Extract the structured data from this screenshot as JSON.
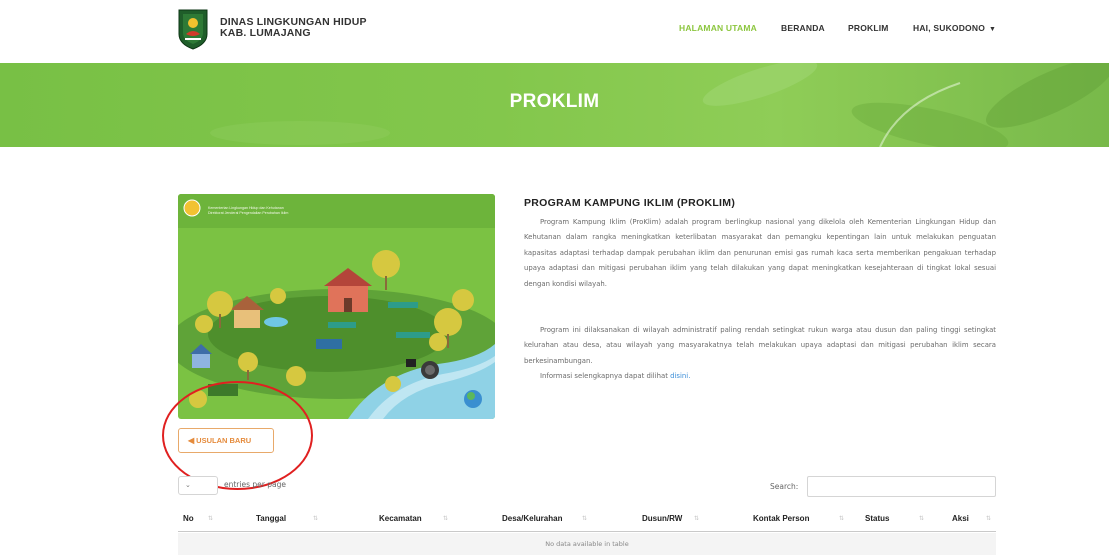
{
  "header": {
    "brand_line1": "DINAS LINGKUNGAN HIDUP",
    "brand_line2": "KAB. LUMAJANG",
    "nav": [
      {
        "label": "HALAMAN UTAMA"
      },
      {
        "label": "BERANDA"
      },
      {
        "label": "PROKLIM"
      },
      {
        "label": "HAI, SUKODONO"
      }
    ]
  },
  "banner": {
    "title": "PROKLIM"
  },
  "illustration": {
    "header_line1": "Kementerian Lingkungan Hidup dan Kehutanan",
    "header_line2": "Direktorat Jenderal Pengendalian Perubahan Iklim"
  },
  "article": {
    "title": "PROGRAM KAMPUNG IKLIM (PROKLIM)",
    "paragraph1": "Program Kampung Iklim (ProKlim) adalah program berlingkup nasional yang dikelola oleh Kementerian Lingkungan Hidup dan Kehutanan dalam rangka meningkatkan keterlibatan masyarakat dan pemangku kepentingan lain untuk melakukan penguatan kapasitas adaptasi terhadap dampak perubahan iklim dan penurunan emisi gas rumah kaca serta memberikan pengakuan terhadap upaya adaptasi dan mitigasi perubahan iklim yang telah dilakukan yang dapat meningkatkan kesejahteraan di tingkat lokal sesuai dengan kondisi wilayah.",
    "paragraph2": "Program ini dilaksanakan di wilayah administratif paling rendah setingkat rukun warga atau dusun dan paling tinggi setingkat kelurahan atau desa, atau wilayah yang masyarakatnya telah melakukan upaya adaptasi dan mitigasi perubahan iklim secara berkesinambungan.",
    "paragraph3_text": "Informasi selengkapnya dapat dilihat",
    "paragraph3_link": "disini."
  },
  "actions": {
    "new_button": "USULAN BARU"
  },
  "table_controls": {
    "length_value": "10",
    "length_label": "entries per page",
    "search_label": "Search:"
  },
  "table": {
    "columns": [
      "No",
      "Tanggal",
      "Kecamatan",
      "Desa/Kelurahan",
      "Dusun/RW",
      "Kontak Person",
      "Status",
      "Aksi"
    ],
    "empty_text": "No data available in table"
  },
  "colors": {
    "accent_green": "#8cc63e",
    "banner_green": "#80c54b",
    "button_orange": "#e58b3c",
    "annotation_red": "#e02020"
  }
}
